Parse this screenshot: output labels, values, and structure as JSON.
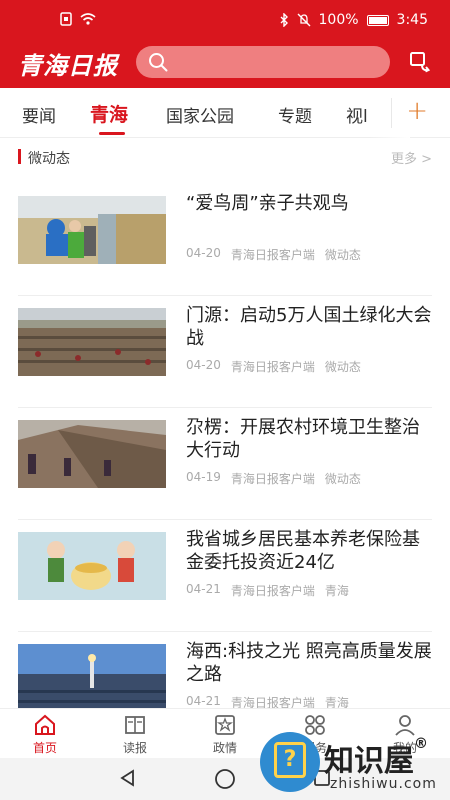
{
  "status": {
    "icons_left": [
      "sim-icon",
      "wifi-icon"
    ],
    "battery": "100%",
    "time": "3:45"
  },
  "header": {
    "logo_text": "青海日报",
    "search_placeholder": ""
  },
  "tabs": [
    {
      "label": "要闻",
      "active": false
    },
    {
      "label": "青海",
      "active": true
    },
    {
      "label": "国家公园",
      "active": false
    },
    {
      "label": "专题",
      "active": false
    },
    {
      "label": "视l",
      "active": false
    }
  ],
  "tab_add": "+",
  "section": {
    "title": "微动态",
    "more": "更多 >"
  },
  "feed": [
    {
      "title": "“爱鸟周”亲子共观鸟",
      "date": "04-20",
      "source": "青海日报客户端",
      "tag": "微动态"
    },
    {
      "title": "门源：启动5万人国土绿化大会战",
      "date": "04-20",
      "source": "青海日报客户端",
      "tag": "微动态"
    },
    {
      "title": "尕楞：开展农村环境卫生整治大行动",
      "date": "04-19",
      "source": "青海日报客户端",
      "tag": "微动态"
    },
    {
      "title": "我省城乡居民基本养老保险基金委托投资近24亿",
      "date": "04-21",
      "source": "青海日报客户端",
      "tag": "青海"
    },
    {
      "title": "海西:科技之光 照亮高质量发展之路",
      "date": "04-21",
      "source": "青海日报客户端",
      "tag": "青海"
    }
  ],
  "bottom_nav": [
    {
      "label": "首页",
      "icon": "home-icon",
      "active": true
    },
    {
      "label": "读报",
      "icon": "newspaper-icon",
      "active": false
    },
    {
      "label": "政情",
      "icon": "government-icon",
      "active": false
    },
    {
      "label": "服务",
      "icon": "grid-icon",
      "active": false
    },
    {
      "label": "我的",
      "icon": "user-icon",
      "active": false
    }
  ],
  "watermark": {
    "text": "知识屋",
    "reg": "®",
    "url": "zhishiwu.com"
  },
  "colors": {
    "brand_red": "#d9161e",
    "tab_add": "#e07a28"
  }
}
